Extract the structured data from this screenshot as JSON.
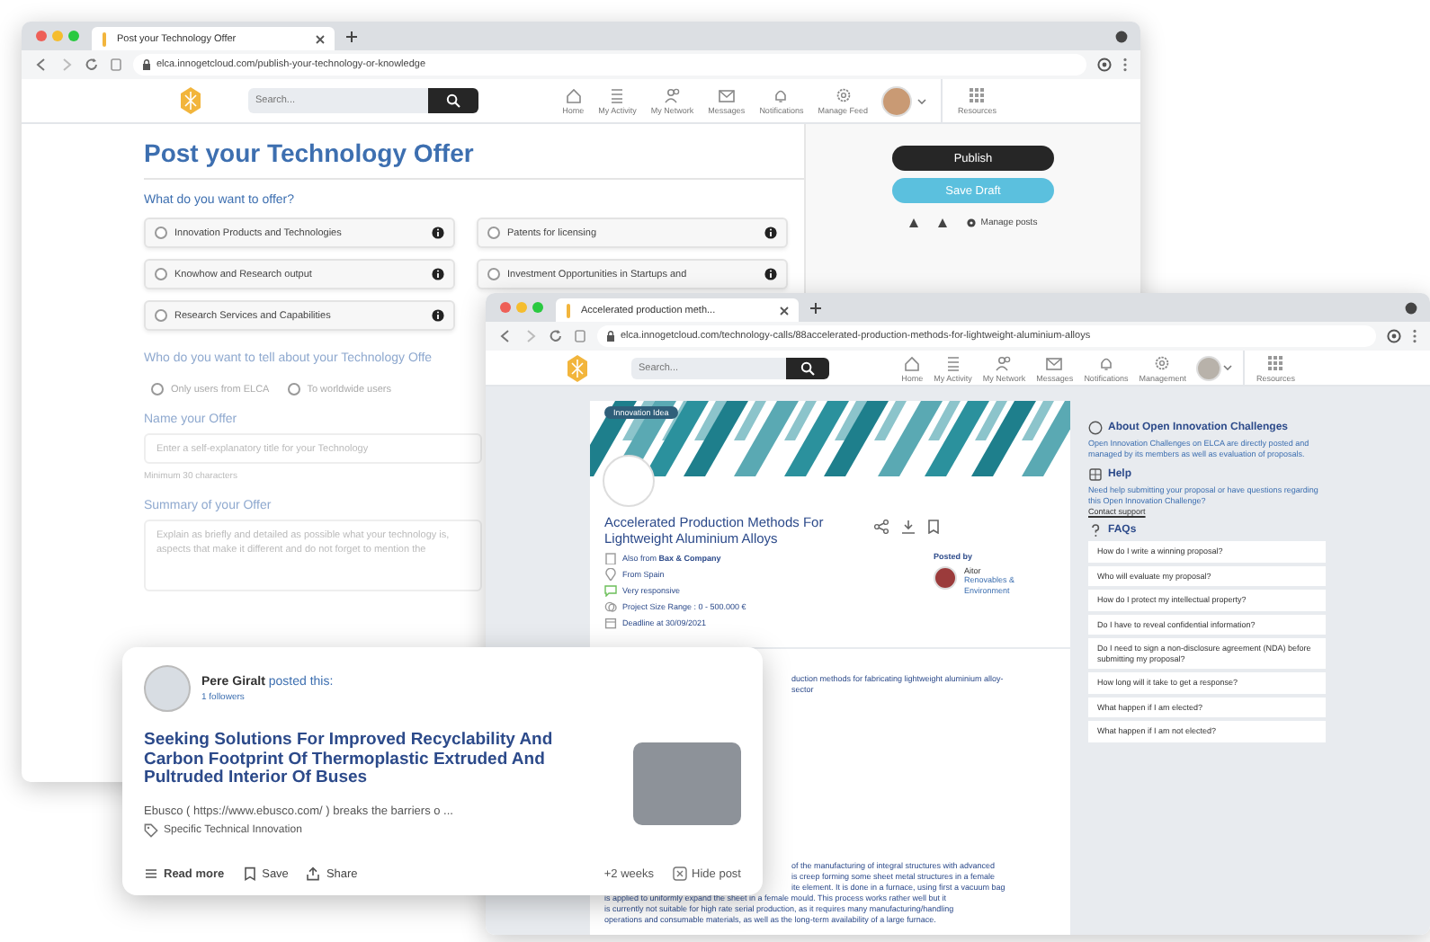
{
  "offer_window": {
    "tab_title": "Post your Technology Offer",
    "url": "elca.innogetcloud.com/publish-your-technology-or-knowledge",
    "search_placeholder": "Search...",
    "nav": [
      "Home",
      "My Activity",
      "My Network",
      "Messages",
      "Notifications",
      "Manage Feed"
    ],
    "resources": "Resources",
    "heading": "Post your Technology Offer",
    "question_offer": "What do you want to offer?",
    "options": [
      {
        "label": "Innovation Products and Technologies",
        "selected": false
      },
      {
        "label": "Patents for licensing",
        "selected": false
      },
      {
        "label": "Knowhow and Research output",
        "selected": false
      },
      {
        "label": "Investment Opportunities in Startups and",
        "selected": false
      },
      {
        "label": "Research Services and Capabilities",
        "selected": false
      }
    ],
    "question_audience": "Who do you want to tell about your Technology Offe",
    "audience": [
      {
        "label": "Only users from ELCA",
        "selected": false
      },
      {
        "label": "To worldwide users",
        "selected": false
      }
    ],
    "name_label": "Name your Offer",
    "name_placeholder": "Enter a self-explanatory title for your Technology",
    "name_hint": "Minimum 30 characters",
    "summary_label": "Summary of your Offer",
    "summary_placeholder": "Explain as briefly and detailed as possible what your technology is, aspects that make it different and do not forget to mention the",
    "publish": "Publish",
    "save_draft": "Save Draft",
    "manage_posts": "Manage posts"
  },
  "challenge_window": {
    "tab_title": "Accelerated production meth...",
    "url": "elca.innogetcloud.com/technology-calls/88accelerated-production-methods-for-lightweight-aluminium-alloys",
    "search_placeholder": "Search...",
    "nav": [
      "Home",
      "My Activity",
      "My Network",
      "Messages",
      "Notifications",
      "Management"
    ],
    "resources": "Resources",
    "badge": "Innovation Idea",
    "title": "Accelerated Production Methods For Lightweight Aluminium Alloys",
    "facts": [
      {
        "kind": "company",
        "text": "Also from **Bax & Company**"
      },
      {
        "kind": "location",
        "text": "From Spain"
      },
      {
        "kind": "response",
        "text": "Very responsive"
      },
      {
        "kind": "budget",
        "text": "Project Size Range : 0 - 500.000 €"
      },
      {
        "kind": "deadline",
        "text": "Deadline at 30/09/2021"
      }
    ],
    "posted_by_label": "Posted by",
    "poster_name": "Aitor",
    "poster_org": "Renovables & Environment",
    "description": [
      {
        "kind": "partial",
        "text": "duction methods for fabricating lightweight aluminium alloy-"
      },
      {
        "kind": "partial",
        "text": "sector"
      }
    ],
    "paragraph": [
      {
        "kind": "partial",
        "text": "of the manufacturing of integral structures with advanced"
      },
      {
        "kind": "partial",
        "text": "is creep forming some sheet metal structures in a female"
      },
      {
        "kind": "partial",
        "text": "ite element. It is done in a furnace, using first a vacuum bag"
      },
      {
        "kind": "full",
        "text": "is applied to uniformly expand the sheet in a female mould. This process works rather well but it"
      },
      {
        "kind": "full",
        "text": "is currently not suitable for high rate serial production, as it requires many manufacturing/handling"
      },
      {
        "kind": "full",
        "text": "operations and consumable materials, as well as the long-term availability of a large furnace."
      }
    ],
    "about_title": "About Open Innovation Challenges",
    "about_text": "Open Innovation Challenges on ELCA are directly posted and managed by its members as well as evaluation of proposals.",
    "help_title": "Help",
    "help_text": "Need help submitting your proposal or have questions regarding this Open Innovation Challenge?",
    "help_link": "Contact support",
    "faq_title": "FAQs",
    "faqs": [
      "How do I write a winning proposal?",
      "Who will evaluate my proposal?",
      "How do I protect my intellectual property?",
      "Do I have to reveal confidential information?",
      "Do I need to sign a non-disclosure agreement (NDA) before submitting my proposal?",
      "How long will it take to get a response?",
      "What happen if I am elected?",
      "What happen if I am not elected?"
    ]
  },
  "post_card": {
    "author": "**Pere Giralt** posted this:",
    "followers": "1 followers",
    "title": "Seeking Solutions For Improved Recyclability And Carbon Footprint Of Thermoplastic Extruded And Pultruded Interior Of Buses",
    "excerpt": "Ebusco ( https://www.ebusco.com/ ) breaks the barriers o ...",
    "tag": "Specific Technical Innovation",
    "age": "+2 weeks",
    "hide": "Hide post",
    "actions": [
      "Read more",
      "Save",
      "Share"
    ]
  }
}
